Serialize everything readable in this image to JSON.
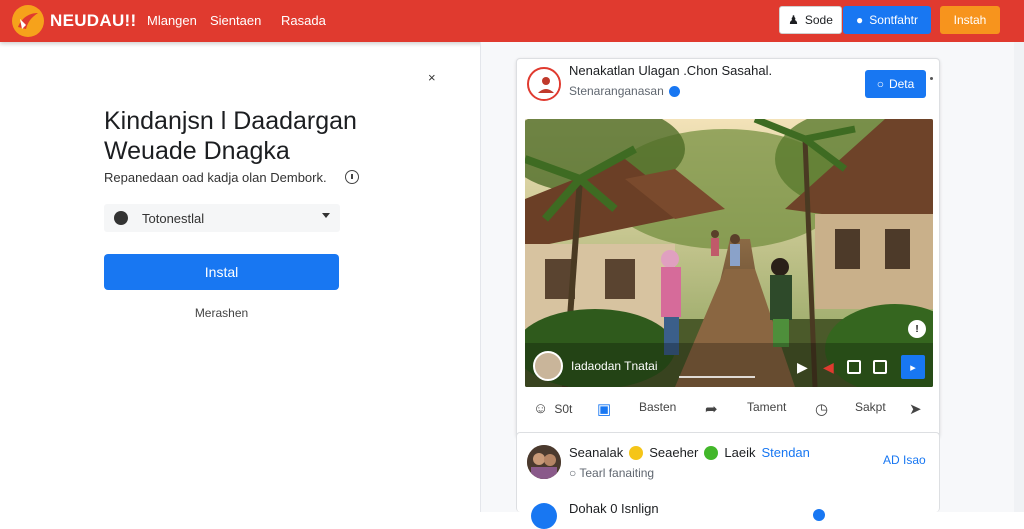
{
  "topbar": {
    "brand": "NEUDAU!!",
    "nav": [
      "Mlangen",
      "Sientaen",
      "Rasada"
    ],
    "btn_white": "Sode",
    "btn_blue": "Sontfahtr",
    "btn_orange": "Instah",
    "colors": {
      "bar": "#e03a2f",
      "blue": "#1877f2",
      "orange": "#f7941d"
    }
  },
  "left": {
    "close_icon": "×",
    "headline_1": "Kindanjsn l Daadargan",
    "headline_2": "Weuade Dnagka",
    "subline": "Repanedaan oad kadja olan Dembork.",
    "select_value": "Totonestlal",
    "install_label": "Instal",
    "secondary_link": "Merashen"
  },
  "post": {
    "title": "Nenakatlan Ulagan .Chon Sasahal.",
    "subtitle": "Stenaranganasan",
    "follow_label": "Deta",
    "video_caption": "Iadaodan Tnatai",
    "side_badge": "!",
    "blue_control": "▸",
    "actions": [
      {
        "icon": "haha-reaction-icon",
        "label": "S0t"
      },
      {
        "icon": "comment-icon",
        "label": ""
      },
      {
        "icon": "",
        "label": "Basten"
      },
      {
        "icon": "share-icon",
        "label": ""
      },
      {
        "icon": "",
        "label": "Tament"
      },
      {
        "icon": "clock-icon",
        "label": ""
      },
      {
        "icon": "",
        "label": "Sakpt"
      },
      {
        "icon": "share-arrow-icon",
        "label": ""
      }
    ]
  },
  "comment": {
    "name": "Seanalak",
    "name_extra": "Seaeher",
    "tag": "Laeik",
    "follow": "Stendan",
    "meta": "Tearl fanaiting",
    "count": "AD Isao",
    "second_name": "Dohak 0 Isnlign"
  }
}
